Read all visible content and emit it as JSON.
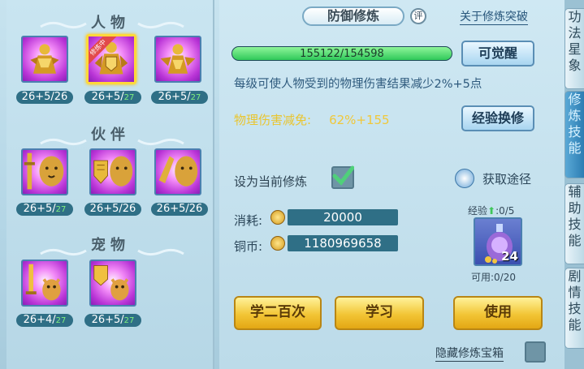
{
  "sections": {
    "characters": "人物",
    "partners": "伙伴",
    "pets": "宠物"
  },
  "slots": [
    {
      "badge": "",
      "level": "26+5/26",
      "extra": ""
    },
    {
      "badge": "修炼中",
      "level": "26+5/",
      "extra": "27"
    },
    {
      "badge": "",
      "level": "26+5/",
      "extra": "27"
    },
    {
      "badge": "",
      "level": "26+5/",
      "extra": "27"
    },
    {
      "badge": "",
      "level": "26+5/26",
      "extra": ""
    },
    {
      "badge": "",
      "level": "26+5/26",
      "extra": ""
    },
    {
      "badge": "",
      "level": "26+4/",
      "extra": "27"
    },
    {
      "badge": "",
      "level": "26+5/",
      "extra": "27"
    }
  ],
  "header": {
    "title": "防御修炼",
    "ping": "评",
    "link": "关于修炼突破"
  },
  "progress": {
    "text": "155122/154598",
    "fraction": 1.0
  },
  "buttons": {
    "awaken": "可觉醒",
    "exchange": "经验换修",
    "learn100": "学二百次",
    "learn": "学习",
    "use": "使用"
  },
  "desc": "每级可使人物受到的物理伤害结果减少2%+5点",
  "reduction": {
    "label": "物理伤害减免:",
    "value": "62%+155"
  },
  "set_current": "设为当前修炼",
  "acquire": "获取途径",
  "cost": {
    "label": "消耗:",
    "value": "20000"
  },
  "copper": {
    "label": "铜币:",
    "value": "1180969658"
  },
  "exp": {
    "label": "经验",
    "value": ":0/5"
  },
  "item": {
    "count": "24",
    "available": "可用:0/20"
  },
  "hide_box": "隐藏修炼宝箱",
  "side_tabs": [
    "功法星象",
    "修炼技能",
    "辅助技能",
    "剧情技能"
  ]
}
